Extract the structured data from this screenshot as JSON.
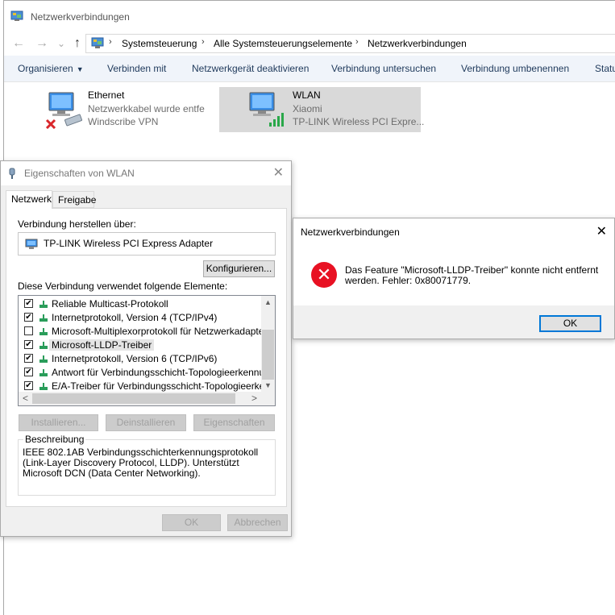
{
  "window": {
    "title": "Netzwerkverbindungen"
  },
  "nav": {
    "back": "←",
    "forward": "→",
    "recent": "⌄",
    "up": "↑"
  },
  "breadcrumb": [
    "Systemsteuerung",
    "Alle Systemsteuerungselemente",
    "Netzwerkverbindungen"
  ],
  "breadcrumb_sep": "›",
  "commands": [
    "Organisieren",
    "Verbinden mit",
    "Netzwerkgerät deaktivieren",
    "Verbindung untersuchen",
    "Verbindung umbenennen",
    "Statu"
  ],
  "commands_dropdown": "▼",
  "connections": [
    {
      "name": "Ethernet",
      "line2": "Netzwerkkabel wurde entfe",
      "line3": "Windscribe VPN",
      "selected": false
    },
    {
      "name": "WLAN",
      "line2": "Xiaomi",
      "line3": "TP-LINK Wireless PCI Expre...",
      "selected": true
    }
  ],
  "properties": {
    "title": "Eigenschaften von WLAN",
    "close": "✕",
    "tabs": [
      "Netzwerk",
      "Freigabe"
    ],
    "connect_using_label": "Verbindung herstellen über:",
    "adapter": "TP-LINK Wireless PCI Express Adapter",
    "configure_button": "Konfigurieren...",
    "items_label": "Diese Verbindung verwendet folgende Elemente:",
    "items": [
      {
        "label": "Reliable Multicast-Protokoll",
        "checked": true,
        "icon": "protocol-icon"
      },
      {
        "label": "Internetprotokoll, Version 4 (TCP/IPv4)",
        "checked": true,
        "icon": "protocol-icon"
      },
      {
        "label": "Microsoft-Multiplexorprotokoll für Netzwerkadapter",
        "checked": false,
        "icon": "protocol-icon"
      },
      {
        "label": "Microsoft-LLDP-Treiber",
        "checked": true,
        "icon": "protocol-icon",
        "highlighted": true
      },
      {
        "label": "Internetprotokoll, Version 6 (TCP/IPv6)",
        "checked": true,
        "icon": "protocol-icon"
      },
      {
        "label": "Antwort für Verbindungsschicht-Topologieerkennung",
        "checked": true,
        "icon": "protocol-icon"
      },
      {
        "label": "E/A-Treiber für Verbindungsschicht-Topologieerkennung",
        "checked": true,
        "icon": "protocol-icon"
      }
    ],
    "scroll": {
      "up": "▲",
      "down": "▼",
      "left": "<",
      "right": ">"
    },
    "install_button": "Installieren...",
    "uninstall_button": "Deinstallieren",
    "properties_button": "Eigenschaften",
    "description_title": "Beschreibung",
    "description": "IEEE 802.1AB Verbindungsschichterkennungsprotokoll (Link-Layer Discovery Protocol, LLDP). Unterstützt Microsoft DCN (Data Center Networking).",
    "ok_button": "OK",
    "cancel_button": "Abbrechen"
  },
  "error_dialog": {
    "title": "Netzwerkverbindungen",
    "close": "✕",
    "icon_glyph": "✕",
    "message": "Das Feature \"Microsoft-LLDP-Treiber\" konnte nicht entfernt werden. Fehler: 0x80071779.",
    "ok_button": "OK"
  },
  "colors": {
    "accent": "#0078d7",
    "error": "#e81123",
    "command_text": "#1e395b",
    "selected_tile": "#d9d9d9"
  }
}
